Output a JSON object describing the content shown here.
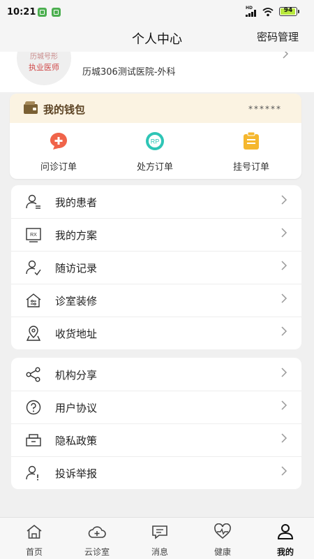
{
  "status_bar": {
    "time": "10:21",
    "network_label": "HD",
    "battery_text": "94",
    "battery_level": 0.94
  },
  "header": {
    "title": "个人中心",
    "action": "密码管理"
  },
  "profile": {
    "avatar_line1": "历城号形",
    "avatar_line2": "执业医师",
    "hospital": "历城306测试医院-外科"
  },
  "wallet": {
    "title": "我的钱包",
    "balance": "******",
    "orders": [
      {
        "label": "问诊订单",
        "icon": "consult-order-icon",
        "color": "#f0644a"
      },
      {
        "label": "处方订单",
        "icon": "rp-order-icon",
        "color": "#2ec5b6",
        "icon_text": "RP"
      },
      {
        "label": "挂号订单",
        "icon": "register-order-icon",
        "color": "#f5b72e"
      }
    ]
  },
  "menu_group_1": [
    {
      "label": "我的患者",
      "icon": "patient-icon"
    },
    {
      "label": "我的方案",
      "icon": "rx-plan-icon",
      "icon_text": "RX"
    },
    {
      "label": "随访记录",
      "icon": "followup-icon"
    },
    {
      "label": "诊室装修",
      "icon": "clinic-decor-icon"
    },
    {
      "label": "收货地址",
      "icon": "address-pin-icon"
    }
  ],
  "menu_group_2": [
    {
      "label": "机构分享",
      "icon": "share-icon"
    },
    {
      "label": "用户协议",
      "icon": "question-icon"
    },
    {
      "label": "隐私政策",
      "icon": "privacy-icon"
    },
    {
      "label": "投诉举报",
      "icon": "complaint-icon"
    }
  ],
  "bottom_nav": [
    {
      "label": "首页",
      "icon": "home-icon",
      "active": false
    },
    {
      "label": "云诊室",
      "icon": "cloud-clinic-icon",
      "active": false
    },
    {
      "label": "消息",
      "icon": "message-icon",
      "active": false
    },
    {
      "label": "健康",
      "icon": "health-icon",
      "active": false
    },
    {
      "label": "我的",
      "icon": "profile-icon",
      "active": true
    }
  ],
  "colors": {
    "wallet_header_bg": "#fbf3e2",
    "wallet_title": "#5b4222",
    "battery_fill": "#b9e93c",
    "page_bg": "#f0f0f0"
  }
}
